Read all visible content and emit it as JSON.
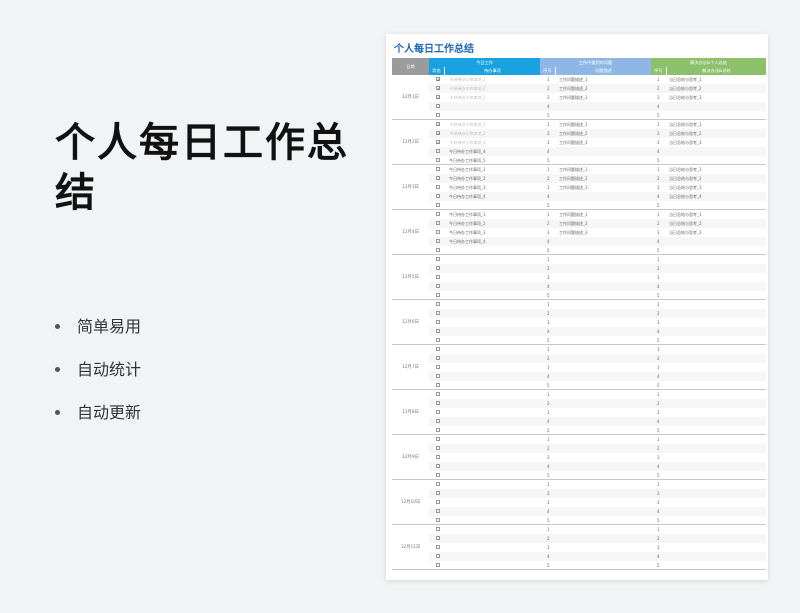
{
  "hero": {
    "title": "个人每日工作总结"
  },
  "features": [
    "简单易用",
    "自动统计",
    "自动更新"
  ],
  "sheet": {
    "title": "个人每日工作总结",
    "header": {
      "date": "日期",
      "today_work": "今日工作",
      "problems": "工作中遇到的问题",
      "solutions": "解决办法&个人总结",
      "status": "状态",
      "todo": "待办事项",
      "seq1": "序号",
      "problem_desc": "问题描述",
      "seq2": "序号",
      "solution_desc": "解决办法&总结"
    },
    "days": [
      {
        "date": "12月1日",
        "rows": [
          {
            "check": true,
            "task": "今日待办工作事项_1",
            "p": "工作问题描述_1",
            "s": "当日总结与思考_1"
          },
          {
            "check": true,
            "task": "今日待办工作事项_2",
            "p": "工作问题描述_2",
            "s": "当日总结与思考_2"
          },
          {
            "check": true,
            "task": "今日待办工作事项_3",
            "p": "工作问题描述_3",
            "s": "当日总结与思考_3"
          },
          {
            "check": false,
            "task": "",
            "p": "",
            "s": ""
          },
          {
            "check": false,
            "task": "",
            "p": "",
            "s": ""
          }
        ]
      },
      {
        "date": "12月2日",
        "rows": [
          {
            "check": true,
            "task": "今日待办工作事项_1",
            "p": "工作问题描述_1",
            "s": "当日总结与思考_1"
          },
          {
            "check": true,
            "task": "今日待办工作事项_2",
            "p": "工作问题描述_2",
            "s": "当日总结与思考_2"
          },
          {
            "check": true,
            "task": "今日待办工作事项_3",
            "p": "工作问题描述_3",
            "s": "当日总结与思考_3"
          },
          {
            "check": false,
            "task": "今日待办工作事项_4",
            "p": "",
            "s": ""
          },
          {
            "check": false,
            "task": "今日待办工作事项_5",
            "p": "",
            "s": ""
          }
        ]
      },
      {
        "date": "12月3日",
        "rows": [
          {
            "check": false,
            "task": "今日待办工作事项_1",
            "p": "工作问题描述_1",
            "s": "当日总结与思考_1"
          },
          {
            "check": false,
            "task": "今日待办工作事项_2",
            "p": "工作问题描述_2",
            "s": "当日总结与思考_2"
          },
          {
            "check": false,
            "task": "今日待办工作事项_3",
            "p": "工作问题描述_3",
            "s": "当日总结与思考_3"
          },
          {
            "check": false,
            "task": "今日待办工作事项_4",
            "p": "",
            "s": "当日总结与思考_4"
          },
          {
            "check": false,
            "task": "",
            "p": "",
            "s": ""
          }
        ]
      },
      {
        "date": "12月4日",
        "rows": [
          {
            "check": false,
            "task": "今日待办工作事项_1",
            "p": "工作问题描述_1",
            "s": "当日总结与思考_1"
          },
          {
            "check": false,
            "task": "今日待办工作事项_2",
            "p": "工作问题描述_2",
            "s": "当日总结与思考_2"
          },
          {
            "check": false,
            "task": "今日待办工作事项_3",
            "p": "工作问题描述_3",
            "s": "当日总结与思考_3"
          },
          {
            "check": false,
            "task": "今日待办工作事项_4",
            "p": "",
            "s": ""
          },
          {
            "check": false,
            "task": "",
            "p": "",
            "s": ""
          }
        ]
      },
      {
        "date": "12月5日",
        "rows": []
      },
      {
        "date": "12月6日",
        "rows": []
      },
      {
        "date": "12月7日",
        "rows": []
      },
      {
        "date": "12月8日",
        "rows": []
      },
      {
        "date": "12月9日",
        "rows": []
      },
      {
        "date": "12月10日",
        "rows": []
      },
      {
        "date": "12月11日",
        "rows": []
      }
    ]
  },
  "colors": {
    "blue": "#1aa1e0",
    "lightblue": "#8fb7e6",
    "green": "#8dc06a",
    "gray": "#9b9b9b",
    "title": "#1b66b0"
  }
}
